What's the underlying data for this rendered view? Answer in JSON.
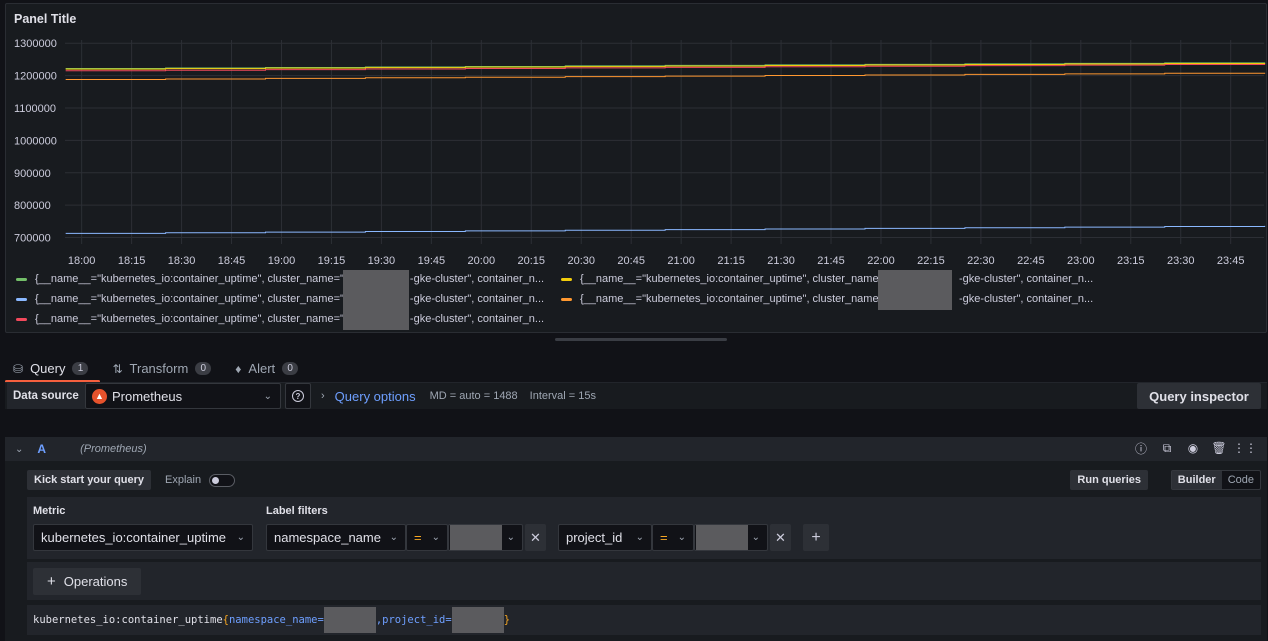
{
  "panel": {
    "title": "Panel Title"
  },
  "chart_data": {
    "type": "line",
    "y_ticks": [
      "700000",
      "800000",
      "900000",
      "1000000",
      "1100000",
      "1200000",
      "1300000"
    ],
    "x_ticks": [
      "18:00",
      "18:15",
      "18:30",
      "18:45",
      "19:00",
      "19:15",
      "19:30",
      "19:45",
      "20:00",
      "20:15",
      "20:30",
      "20:45",
      "21:00",
      "21:15",
      "21:30",
      "21:45",
      "22:00",
      "22:15",
      "22:30",
      "22:45",
      "23:00",
      "23:15",
      "23:30",
      "23:45"
    ],
    "ylim": [
      680000,
      1310000
    ],
    "x_range": [
      "17:55",
      "23:55"
    ],
    "grid": true,
    "legend_placement": "bottom",
    "series": [
      {
        "color": "#73bf69",
        "values": [
          [
            17.92,
            1222000
          ],
          [
            23.92,
            1241000
          ]
        ]
      },
      {
        "color": "#f2cc0c",
        "values": [
          [
            17.92,
            1220000
          ],
          [
            23.92,
            1239000
          ]
        ]
      },
      {
        "color": "#8ab8ff",
        "values": [
          [
            17.92,
            713000
          ],
          [
            23.92,
            736000
          ]
        ]
      },
      {
        "color": "#ff9830",
        "values": [
          [
            17.92,
            1188000
          ],
          [
            23.92,
            1209000
          ]
        ]
      },
      {
        "color": "#f2495c",
        "values": [
          [
            17.92,
            1215000
          ],
          [
            23.92,
            1236000
          ]
        ]
      }
    ]
  },
  "legend": [
    {
      "color": "#73bf69",
      "prefix": "{__name__=\"kubernetes_io:container_uptime\", cluster_name=\"",
      "suffix": "-gke-cluster\", container_n..."
    },
    {
      "color": "#f2cc0c",
      "prefix": "{__name__=\"kubernetes_io:container_uptime\", cluster_name=",
      "suffix": "-gke-cluster\", container_n..."
    },
    {
      "color": "#8ab8ff",
      "prefix": "{__name__=\"kubernetes_io:container_uptime\", cluster_name=\"",
      "suffix": "-gke-cluster\", container_n..."
    },
    {
      "color": "#ff9830",
      "prefix": "{__name__=\"kubernetes_io:container_uptime\", cluster_name=",
      "suffix": "-gke-cluster\", container_n..."
    },
    {
      "color": "#f2495c",
      "prefix": "{__name__=\"kubernetes_io:container_uptime\", cluster_name=\"",
      "suffix": "-gke-cluster\", container_n..."
    }
  ],
  "tabs": [
    {
      "label": "Query",
      "count": "1",
      "icon": "database-icon"
    },
    {
      "label": "Transform",
      "count": "0",
      "icon": "transform-icon"
    },
    {
      "label": "Alert",
      "count": "0",
      "icon": "bell-icon"
    }
  ],
  "toolbar": {
    "datasource_label": "Data source",
    "datasource": "Prometheus",
    "query_options_title": "Query options",
    "md": "MD = auto = 1488",
    "interval": "Interval = 15s",
    "query_inspector": "Query inspector"
  },
  "query": {
    "ref": "A",
    "datasource": "(Prometheus)",
    "kick_start": "Kick start your query",
    "explain": "Explain",
    "run_queries": "Run queries",
    "mode_builder": "Builder",
    "mode_code": "Code",
    "metric_label": "Metric",
    "metric": "kubernetes_io:container_uptime",
    "label_filters_label": "Label filters",
    "filters": [
      {
        "label": "namespace_name",
        "op": "="
      },
      {
        "label": "project_id",
        "op": "="
      }
    ],
    "operations": "Operations",
    "preview_metric": "kubernetes_io:container_uptime",
    "preview_open": "{",
    "preview_ns": "namespace_name=",
    "preview_sep": ", ",
    "preview_pid": "project_id=",
    "preview_close": "}"
  }
}
